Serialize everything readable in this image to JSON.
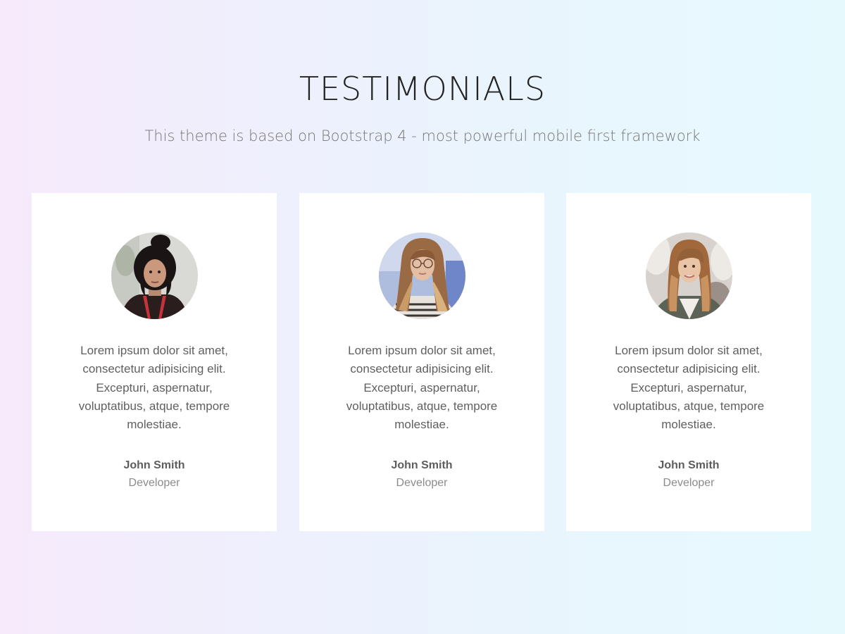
{
  "section": {
    "title": "TESTIMONIALS",
    "subtitle": "This theme is based on Bootstrap 4 - most powerful mobile first framework"
  },
  "testimonials": [
    {
      "avatar_icon": "person-portrait-dark-hair",
      "quote": "Lorem ipsum dolor sit amet, consectetur adipisicing elit. Excepturi, aspernatur, voluptatibus, atque, tempore molestiae.",
      "name": "John Smith",
      "role": "Developer"
    },
    {
      "avatar_icon": "person-portrait-glasses",
      "quote": "Lorem ipsum dolor sit amet, consectetur adipisicing elit. Excepturi, aspernatur, voluptatibus, atque, tempore molestiae.",
      "name": "John Smith",
      "role": "Developer"
    },
    {
      "avatar_icon": "person-portrait-long-hair",
      "quote": "Lorem ipsum dolor sit amet, consectetur adipisicing elit. Excepturi, aspernatur, voluptatibus, atque, tempore molestiae.",
      "name": "John Smith",
      "role": "Developer"
    }
  ],
  "colors": {
    "card_background": "#ffffff",
    "title_text": "#232323",
    "body_text": "#5f5f5f",
    "muted_text": "#8b8b8b"
  }
}
